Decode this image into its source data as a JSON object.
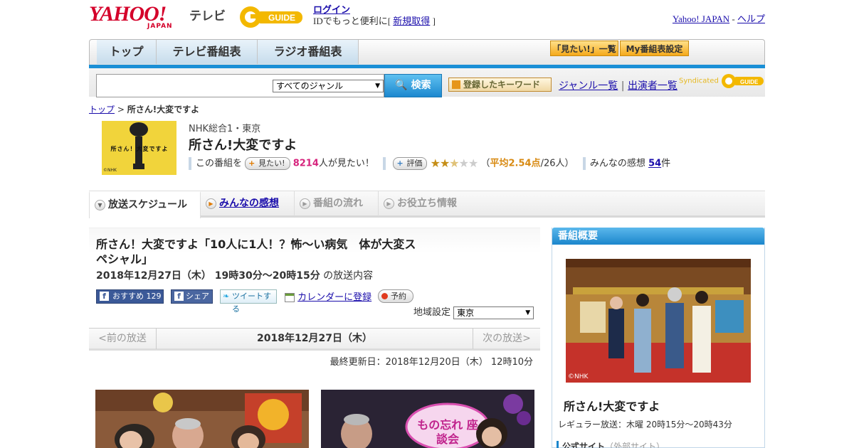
{
  "header": {
    "logo_yahoo": "YAHOO!",
    "logo_japan": "JAPAN",
    "logo_tv": "テレビ",
    "gguide_logo": "G GUIDE",
    "login": "ログイン",
    "id_text_prefix": "IDでもっと便利に[",
    "new_signup": "新規取得",
    "id_text_suffix": "]",
    "yahoo_japan_link": "Yahoo! JAPAN",
    "dash": " - ",
    "help_link": "ヘルプ"
  },
  "gnav": {
    "tabs": [
      "トップ",
      "テレビ番組表",
      "ラジオ番組表"
    ],
    "mitai_list": "「見たい!」一覧",
    "my_settings": "My番組表設定"
  },
  "search": {
    "genre_selected": "すべてのジャンル",
    "button": "検索",
    "keyword_button": "登録したキーワード",
    "genre_list": "ジャンル一覧",
    "divider": "|",
    "performer_list": "出演者一覧",
    "syndicated": "Syndicated"
  },
  "breadcrumb": {
    "top": "トップ",
    "sep": " > ",
    "current": "所さん!大変ですよ"
  },
  "program": {
    "channel": "NHK総合1・東京",
    "title": "所さん!大変ですよ",
    "thumb_text": "所さん！大変ですよ",
    "thumb_credit": "©NHK",
    "want_prefix": "この番組を",
    "want_button": "見たい!",
    "want_count": "8214",
    "want_suffix": "人が見たい！",
    "rate_button": "評価",
    "stars_on": "★★",
    "stars_half": "★",
    "stars_off": "★★",
    "rating_open": "（",
    "avg_label": "平均2.54点",
    "rating_people": "/26人）",
    "impressions_label": "みんなの感想",
    "impressions_count": "54",
    "impressions_suffix": "件"
  },
  "subtabs": [
    "放送スケジュール",
    "みんなの感想",
    "番組の流れ",
    "お役立ち情報"
  ],
  "episode": {
    "title": "所さん！大変ですよ「10人に1人！？怖～い病気　体が大変スペシャル」",
    "date": "2018年12月27日（木）  19時30分～20時15分",
    "date_suffix": " の放送内容",
    "fb_recommend": "おすすめ",
    "fb_count": "129",
    "fb_share": "シェア",
    "tweet": "ツイートする",
    "calendar": "カレンダーに登録",
    "reserve": "予約",
    "region_label": "地域設定",
    "region_value": "東京"
  },
  "datenav": {
    "prev": "<前の放送",
    "current": "2018年12月27日（木）",
    "next": "次の放送>"
  },
  "updated": "最終更新日：2018年12月20日（木）  12時10分",
  "photos": {
    "card_text": "もの忘れ 座談会"
  },
  "sidebar": {
    "heading": "番組概要",
    "image_credit": "©NHK",
    "title": "所さん!大変ですよ",
    "regular": "レギュラー放送：木曜 20時15分～20時43分",
    "official_site": "公式サイト",
    "external": "（外部サイト）"
  },
  "colors": {
    "accent_blue": "#1a8fd6",
    "yahoo_red": "#d4002a",
    "link": "#1a0dab",
    "pink_count": "#d6247d",
    "star_gold": "#c58e17"
  }
}
